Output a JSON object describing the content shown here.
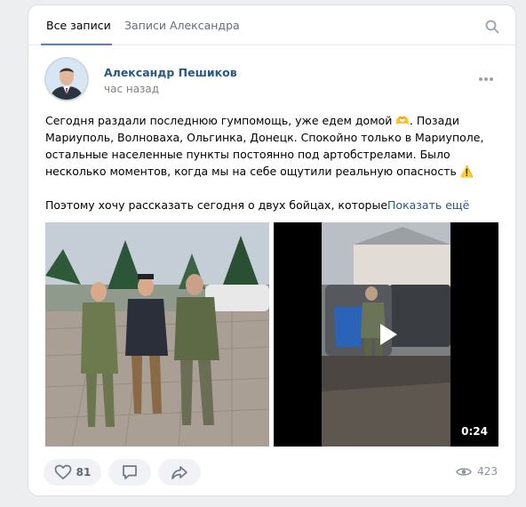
{
  "tabs": [
    {
      "label": "Все записи",
      "active": true
    },
    {
      "label": "Записи Александра",
      "active": false
    }
  ],
  "post": {
    "author": "Александр Пешиков",
    "time": "час назад",
    "text_para1": "Сегодня раздали последнюю гумпомощь, уже едем домой 🫶. Позади Мариуполь, Волноваха, Ольгинка, Донецк. Спокойно только в Мариуполе, остальные населенные пункты постоянно под артобстрелами. Было несколько моментов, когда мы на себе ощутили реальную опасность ⚠️",
    "text_para2": "Поэтому хочу рассказать сегодня о двух бойцах, которые",
    "show_more": "Показать ещё",
    "video_duration": "0:24",
    "likes": "81",
    "views": "423"
  },
  "icons": {
    "search": "search-icon",
    "more": "more-icon",
    "like": "heart-icon",
    "comment": "comment-icon",
    "share": "share-icon",
    "views": "eye-icon",
    "play": "play-icon"
  },
  "colors": {
    "accent": "#5181b8",
    "link": "#2a5885",
    "background": "#edeef0"
  }
}
